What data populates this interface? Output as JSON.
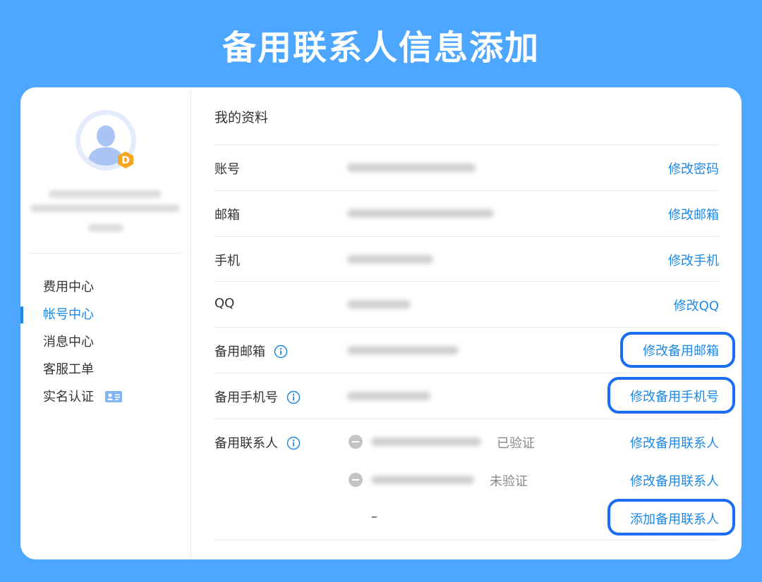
{
  "banner": {
    "title": "备用联系人信息添加"
  },
  "sidebar": {
    "badge_letter": "D",
    "menu": [
      {
        "label": "费用中心"
      },
      {
        "label": "帐号中心"
      },
      {
        "label": "消息中心"
      },
      {
        "label": "客服工单"
      },
      {
        "label": "实名认证"
      }
    ],
    "active_index": 1
  },
  "main": {
    "section_title": "我的资料",
    "rows": [
      {
        "label": "账号",
        "action": "修改密码"
      },
      {
        "label": "邮箱",
        "action": "修改邮箱"
      },
      {
        "label": "手机",
        "action": "修改手机"
      },
      {
        "label": "QQ",
        "action": "修改QQ"
      },
      {
        "label": "备用邮箱",
        "action": "修改备用邮箱"
      },
      {
        "label": "备用手机号",
        "action": "修改备用手机号"
      }
    ],
    "contacts": {
      "label": "备用联系人",
      "entries": [
        {
          "status": "已验证",
          "action": "修改备用联系人"
        },
        {
          "status": "未验证",
          "action": "修改备用联系人"
        }
      ],
      "empty_placeholder": "–",
      "add_action": "添加备用联系人"
    }
  },
  "colors": {
    "background": "#4da6ff",
    "accent": "#1e88e5",
    "highlight_border": "#1a6cf0",
    "badge": "#f5a623"
  }
}
